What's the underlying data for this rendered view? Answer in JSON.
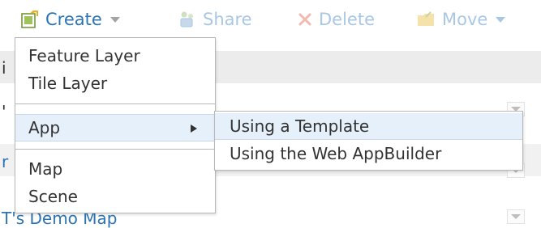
{
  "toolbar": {
    "create_label": "Create",
    "share_label": "Share",
    "delete_label": "Delete",
    "move_label": "Move",
    "accent": "#2c74b3",
    "disabled": "#a9c7e4"
  },
  "menu": {
    "items": [
      {
        "label": "Feature Layer"
      },
      {
        "label": "Tile Layer"
      },
      {
        "label": "App"
      },
      {
        "label": "Map"
      },
      {
        "label": "Scene"
      }
    ]
  },
  "submenu": {
    "items": [
      {
        "label": "Using a Template"
      },
      {
        "label": "Using the Web AppBuilder"
      }
    ]
  },
  "background": {
    "row3_fragment": "T's Demo Map"
  },
  "icons": {
    "create": "create-doc-icon",
    "share": "share-icon",
    "delete": "delete-x-icon",
    "move": "folder-icon",
    "submenu_arrow": "chevron-right-icon",
    "caret": "caret-down-icon"
  }
}
